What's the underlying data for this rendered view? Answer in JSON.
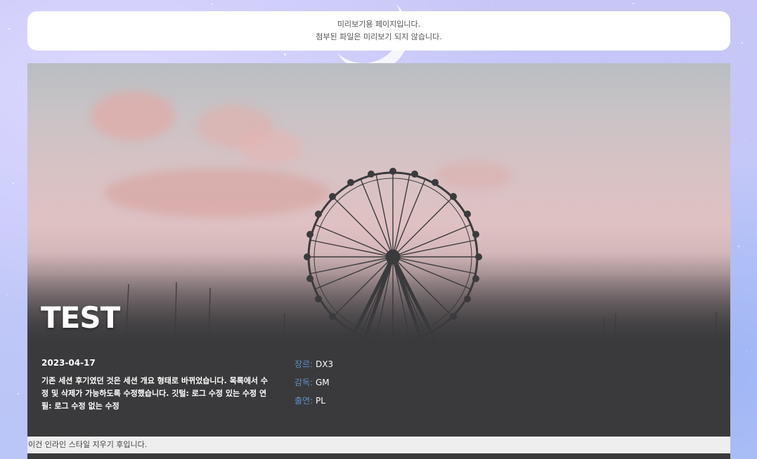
{
  "notice": {
    "line1": "미리보기용 페이지입니다.",
    "line2": "첨부된 파일은 미리보기 되지 않습니다."
  },
  "post": {
    "title": "TEST",
    "date": "2023-04-17",
    "description": "기존 세션 후기였던 것은 세션 개요 형태로 바뀌었습니다. 목록에서 수정 및 삭제가 가능하도록 수정했습니다. 깃털: 로그 수정 있는 수정 연필: 로그 수정 없는 수정",
    "meta": [
      {
        "key": "장르:",
        "value": "DX3"
      },
      {
        "key": "감독:",
        "value": "GM"
      },
      {
        "key": "출연:",
        "value": "PL"
      }
    ],
    "footer_note": "이건 인라인 스타일 지우기 후입니다."
  },
  "colors": {
    "card_bg": "#3a3a3c",
    "meta_key": "#5e90c8",
    "strip_bg": "#eeeeee"
  },
  "icons": [
    "ferris-wheel-image"
  ]
}
